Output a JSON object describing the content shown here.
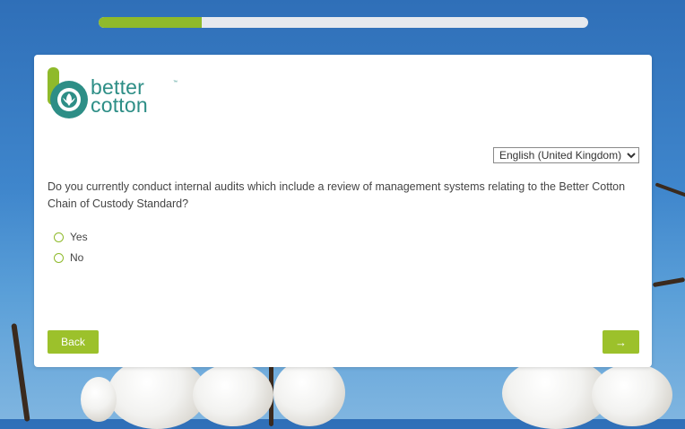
{
  "progress": {
    "percent": 21
  },
  "brand": {
    "line1": "better",
    "line2": "cotton",
    "tm": "™"
  },
  "language": {
    "selected": "English (United Kingdom)",
    "options": [
      "English (United Kingdom)"
    ]
  },
  "question": {
    "text": "Do you currently conduct internal audits which include a review of management systems relating to the Better Cotton Chain of Custody Standard?",
    "options": [
      {
        "label": "Yes"
      },
      {
        "label": "No"
      }
    ]
  },
  "nav": {
    "back_label": "Back",
    "next_label": "→"
  },
  "colors": {
    "accent": "#9cc12b",
    "brand": "#2d8e86",
    "progress": "#8fba2b"
  }
}
